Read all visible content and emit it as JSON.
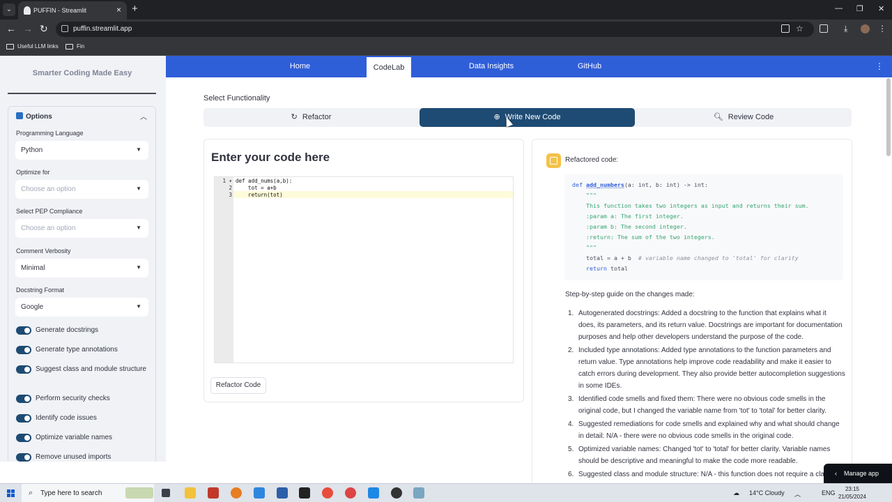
{
  "browser": {
    "tab_title": "PUFFIN - Streamlit",
    "url": "puffin.streamlit.app",
    "bookmarks": [
      "Useful LLM links",
      "Fin"
    ]
  },
  "sidebar": {
    "title": "Smarter Coding Made Easy",
    "options_label": "Options",
    "fields": [
      {
        "label": "Programming Language",
        "value": "Python",
        "placeholder": false
      },
      {
        "label": "Optimize for",
        "value": "Choose an option",
        "placeholder": true
      },
      {
        "label": "Select PEP Compliance",
        "value": "Choose an option",
        "placeholder": true
      },
      {
        "label": "Comment Verbosity",
        "value": "Minimal",
        "placeholder": false
      },
      {
        "label": "Docstring Format",
        "value": "Google",
        "placeholder": false
      }
    ],
    "toggles": [
      {
        "label": "Generate docstrings",
        "on": true
      },
      {
        "label": "Generate type annotations",
        "on": true
      },
      {
        "label": "Suggest class and module structure",
        "on": true
      },
      {
        "label": "Perform security checks",
        "on": true
      },
      {
        "label": "Identify code issues",
        "on": true
      },
      {
        "label": "Optimize variable names",
        "on": true
      },
      {
        "label": "Remove unused imports",
        "on": true
      }
    ]
  },
  "nav": {
    "items": [
      "Home",
      "CodeLab",
      "Data Insights",
      "GitHub"
    ],
    "active": "CodeLab"
  },
  "functionality": {
    "label": "Select Functionality",
    "options": [
      "Refactor",
      "Write New Code",
      "Review Code"
    ],
    "selected": "Write New Code"
  },
  "editor": {
    "heading": "Enter your code here",
    "lines": [
      "def add_nums(a,b):",
      "    tot = a+b",
      "    return(tot)"
    ],
    "button": "Refactor Code"
  },
  "output": {
    "heading": "Refactored code:",
    "code": [
      "def add_numbers(a: int, b: int) -> int:",
      "    \"\"\"",
      "    This function takes two integers as input and returns their sum.",
      "    :param a: The first integer.",
      "    :param b: The second integer.",
      "    :return: The sum of the two integers.",
      "    \"\"\"",
      "    total = a + b  # variable name changed to 'total' for clarity",
      "    return total"
    ],
    "guide_heading": "Step-by-step guide on the changes made:",
    "steps": [
      "Autogenerated docstrings: Added a docstring to the function that explains what it does, its parameters, and its return value. Docstrings are important for documentation purposes and help other developers understand the purpose of the code.",
      "Included type annotations: Added type annotations to the function parameters and return value. Type annotations help improve code readability and make it easier to catch errors during development. They also provide better autocompletion suggestions in some IDEs.",
      "Identified code smells and fixed them: There were no obvious code smells in the original code, but I changed the variable name from 'tot' to 'total' for better clarity.",
      "Suggested remediations for code smells and explained why and what should change in detail: N/A - there were no obvious code smells in the original code.",
      "Optimized variable names: Changed 'tot' to 'total' for better clarity. Variable names should be descriptive and meaningful to make the code more readable.",
      "Suggested class and module structure: N/A - this function does not require a clas"
    ]
  },
  "manage_app": "Manage app",
  "taskbar": {
    "search_placeholder": "Type here to search",
    "weather": "14°C  Cloudy",
    "lang": "ENG",
    "time": "23:15",
    "date": "21/05/2024"
  }
}
